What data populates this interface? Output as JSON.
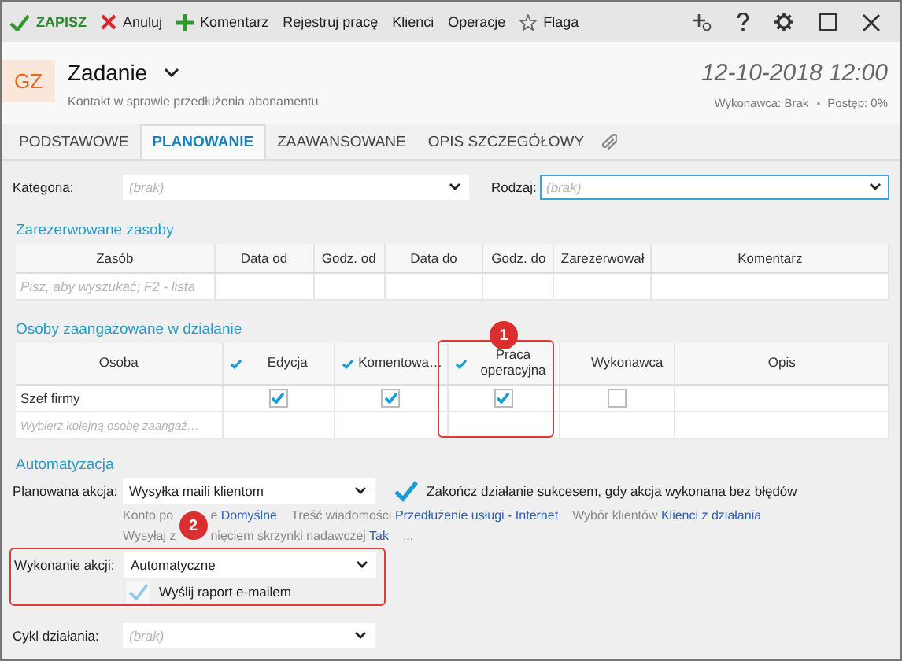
{
  "toolbar": {
    "actions": [
      {
        "label": "ZAPISZ",
        "kind": "check"
      },
      {
        "label": "Anuluj",
        "kind": "cross"
      },
      {
        "label": "Komentarz",
        "kind": "plus"
      },
      {
        "label": "Rejestruj pracę",
        "kind": "plain"
      },
      {
        "label": "Klienci",
        "kind": "plain"
      },
      {
        "label": "Operacje",
        "kind": "plain"
      },
      {
        "label": "Flaga",
        "kind": "star"
      }
    ]
  },
  "header": {
    "avatar": "GZ",
    "title": "Zadanie",
    "subtitle": "Kontakt w sprawie przedłużenia abonamentu",
    "datetime": "12-10-2018 12:00",
    "assignee": "Wykonawca: Brak",
    "progress": "Postęp: 0%"
  },
  "tabs": [
    {
      "label": "PODSTAWOWE",
      "selected": false
    },
    {
      "label": "PLANOWANIE",
      "selected": true
    },
    {
      "label": "ZAAWANSOWANE",
      "selected": false
    },
    {
      "label": "OPIS SZCZEGÓŁOWY",
      "selected": false
    }
  ],
  "category": {
    "label": "Kategoria:",
    "placeholder": "(brak)"
  },
  "kind_field": {
    "label": "Rodzaj:",
    "placeholder": "(brak)",
    "focused": true
  },
  "resources": {
    "title": "Zarezerwowane zasoby",
    "columns": [
      "Zasób",
      "Data od",
      "Godz. od",
      "Data do",
      "Godz. do",
      "Zarezerwował",
      "Komentarz"
    ],
    "search_placeholder": "Pisz, aby wyszukać; F2 - lista"
  },
  "people": {
    "title": "Osoby zaangażowane w działanie",
    "columns": [
      {
        "label": "Osoba",
        "kind": "text"
      },
      {
        "label": "Edycja",
        "kind": "check",
        "header_checked": true
      },
      {
        "label": "Komentowa…",
        "kind": "check",
        "header_checked": true
      },
      {
        "label": "Praca operacyjna",
        "kind": "check",
        "header_checked": true
      },
      {
        "label": "Wykonawca",
        "kind": "check",
        "header_checked": false
      },
      {
        "label": "Opis",
        "kind": "text"
      }
    ],
    "rows": [
      {
        "name": "Szef firmy",
        "checks": [
          true,
          true,
          true,
          false
        ]
      }
    ],
    "new_row_placeholder": "Wybierz kolejną osobę zaangaż…"
  },
  "badges": [
    "1",
    "2"
  ],
  "automation": {
    "title": "Automatyzacja",
    "planned_action": {
      "label": "Planowana akcja:",
      "value": "Wysyłka maili klientom"
    },
    "finish_on_success": {
      "label": "Zakończ działanie sukcesem, gdy akcja wykonana bez błędów",
      "checked": true
    },
    "details": [
      [
        {
          "label": "Konto po"
        },
        {
          "label": "e",
          "value": "Domyślne"
        },
        {
          "label": "Treść wiadomości",
          "value": "Przedłużenie usługi - Internet"
        },
        {
          "label": "Wybór klientów",
          "value": "Klienci z działania"
        }
      ],
      [
        {
          "label": "Wysyłaj z"
        },
        {
          "label": "nięciem skrzynki nadawczej",
          "value": "Tak"
        },
        {
          "label": "..."
        }
      ]
    ],
    "execution": {
      "label": "Wykonanie akcji:",
      "value": "Automatyczne"
    },
    "send_report": {
      "label": "Wyślij raport e-mailem",
      "checked": true,
      "disabled": true
    },
    "cycle": {
      "label": "Cykl działania:",
      "placeholder": "(brak)"
    }
  }
}
